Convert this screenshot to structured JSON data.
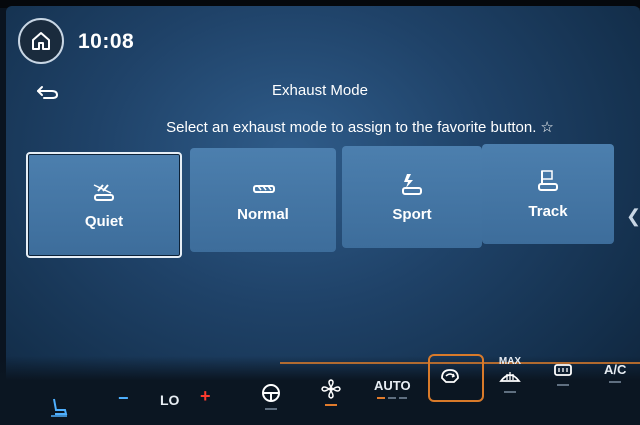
{
  "status_bar": {
    "time": "10:08"
  },
  "header": {
    "title": "Exhaust Mode",
    "instruction": "Select an exhaust mode to assign to the favorite button."
  },
  "modes": [
    {
      "label": "Quiet",
      "icon": "quiet-exhaust-icon",
      "selected": true
    },
    {
      "label": "Normal",
      "icon": "normal-exhaust-icon",
      "selected": false
    },
    {
      "label": "Sport",
      "icon": "sport-exhaust-icon",
      "selected": false
    },
    {
      "label": "Track",
      "icon": "track-exhaust-icon",
      "selected": false
    }
  ],
  "climate_bar": {
    "minus_label": "−",
    "temp": "LO",
    "plus_label": "+",
    "auto": "AUTO",
    "max": "MAX",
    "ac": "A/C"
  },
  "colors": {
    "accent": "#d87a2a",
    "tile": "#4577a6",
    "background": "#1f4268"
  }
}
